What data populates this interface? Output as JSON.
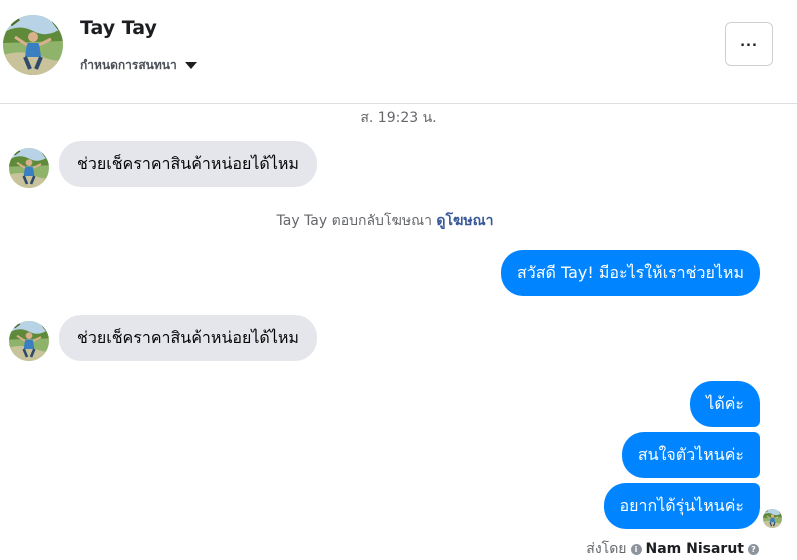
{
  "header": {
    "name": "Tay Tay",
    "manage_label": "กำหนดการสนทนา",
    "more_label": "..."
  },
  "timestamp": "ส. 19:23 น.",
  "messages": [
    {
      "direction": "in",
      "text": "ช่วยเช็คราคาสินค้าหน่อยได้ไหม"
    },
    {
      "direction": "out",
      "text": "สวัสดี Tay! มีอะไรให้เราช่วยไหม"
    },
    {
      "direction": "in",
      "text": "ช่วยเช็คราคาสินค้าหน่อยได้ไหม"
    },
    {
      "direction": "out",
      "text": "ได้ค่ะ"
    },
    {
      "direction": "out",
      "text": "สนใจตัวไหนค่ะ"
    },
    {
      "direction": "out",
      "text": "อยากได้รุ่นไหนค่ะ"
    }
  ],
  "ad_reply": {
    "text": "Tay Tay ตอบกลับโฆษณา",
    "link": "ดูโฆษณา"
  },
  "sent_by": {
    "label": "ส่งโดย",
    "name": "Nam Nisarut"
  },
  "colors": {
    "outgoing_bubble": "#0084ff",
    "incoming_bubble": "#e4e6eb",
    "link": "#385898"
  }
}
